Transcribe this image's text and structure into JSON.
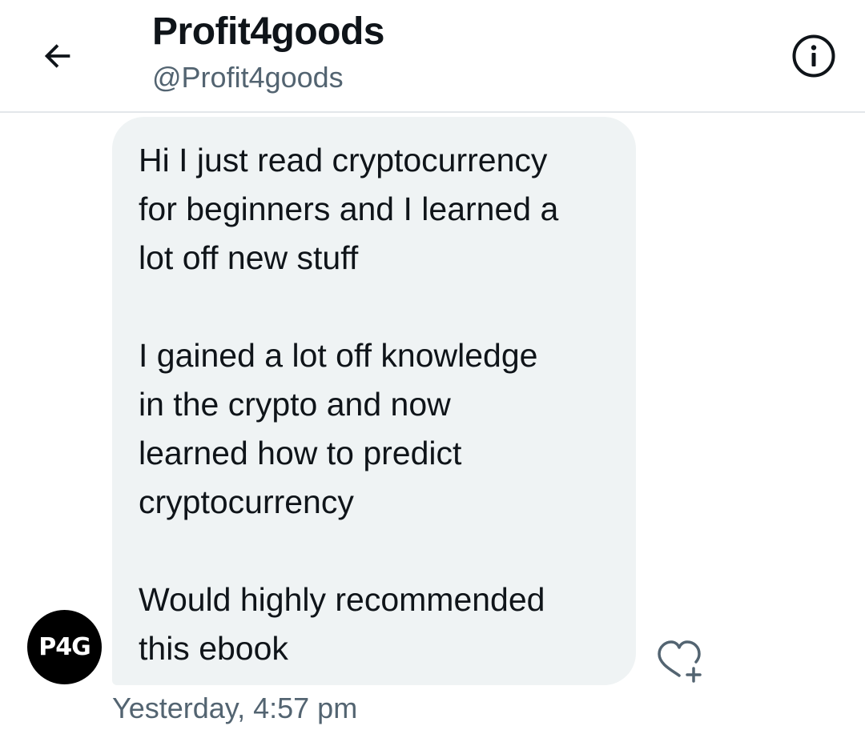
{
  "header": {
    "back_icon": "arrow-left-icon",
    "title": "Profit4goods",
    "handle": "@Profit4goods",
    "info_icon": "info-circle-icon"
  },
  "conversation": {
    "message": {
      "lines": [
        "Hi I just read cryptocurrency",
        "for beginners and I learned a",
        "lot off new stuff",
        "",
        "I gained a lot off knowledge",
        "in the crypto and now",
        "learned how to predict",
        "cryptocurrency",
        "",
        "Would highly recommended",
        "this ebook"
      ],
      "avatar_text": "P4G",
      "timestamp": "Yesterday, 4:57 pm",
      "reaction_icon": "heart-plus-icon"
    }
  },
  "colors": {
    "bubble_bg": "#eff3f4",
    "text_primary": "#0f1419",
    "text_secondary": "#536471",
    "divider": "#e3e7ea",
    "avatar_bg": "#000000"
  }
}
